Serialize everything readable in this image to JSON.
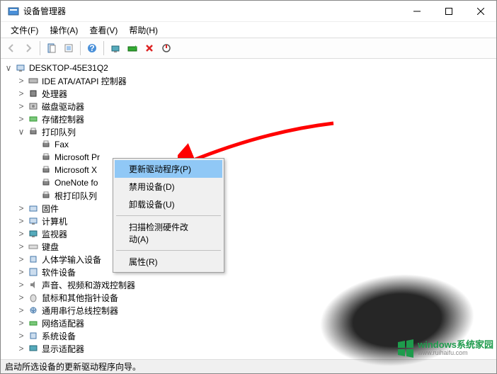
{
  "window": {
    "title": "设备管理器"
  },
  "menubar": {
    "file": "文件(F)",
    "action": "操作(A)",
    "view": "查看(V)",
    "help": "帮助(H)"
  },
  "tree": {
    "root": "DESKTOP-45E31Q2",
    "nodes": [
      {
        "label": "IDE ATA/ATAPI 控制器",
        "icon": "ide"
      },
      {
        "label": "处理器",
        "icon": "cpu"
      },
      {
        "label": "磁盘驱动器",
        "icon": "disk"
      },
      {
        "label": "存储控制器",
        "icon": "storage"
      },
      {
        "label": "打印队列",
        "icon": "printer",
        "expanded": true,
        "children": [
          {
            "label": "Fax",
            "icon": "printer"
          },
          {
            "label": "Microsoft Pr",
            "icon": "printer"
          },
          {
            "label": "Microsoft X",
            "icon": "printer"
          },
          {
            "label": "OneNote fo",
            "icon": "printer"
          },
          {
            "label": "根打印队列",
            "icon": "printer"
          }
        ]
      },
      {
        "label": "固件",
        "icon": "firmware"
      },
      {
        "label": "计算机",
        "icon": "computer"
      },
      {
        "label": "监视器",
        "icon": "monitor"
      },
      {
        "label": "键盘",
        "icon": "keyboard"
      },
      {
        "label": "人体学输入设备",
        "icon": "hid"
      },
      {
        "label": "软件设备",
        "icon": "software"
      },
      {
        "label": "声音、视频和游戏控制器",
        "icon": "sound"
      },
      {
        "label": "鼠标和其他指针设备",
        "icon": "mouse"
      },
      {
        "label": "通用串行总线控制器",
        "icon": "usb"
      },
      {
        "label": "网络适配器",
        "icon": "network"
      },
      {
        "label": "系统设备",
        "icon": "system"
      },
      {
        "label": "显示适配器",
        "icon": "display"
      }
    ]
  },
  "context_menu": {
    "update_driver": "更新驱动程序(P)",
    "disable_device": "禁用设备(D)",
    "uninstall_device": "卸载设备(U)",
    "scan_hardware": "扫描检测硬件改动(A)",
    "properties": "属性(R)"
  },
  "statusbar": {
    "text": "启动所选设备的更新驱动程序向导。"
  },
  "watermark": {
    "brand": "windows系统家园",
    "url": "www.ruihaifu.com"
  }
}
